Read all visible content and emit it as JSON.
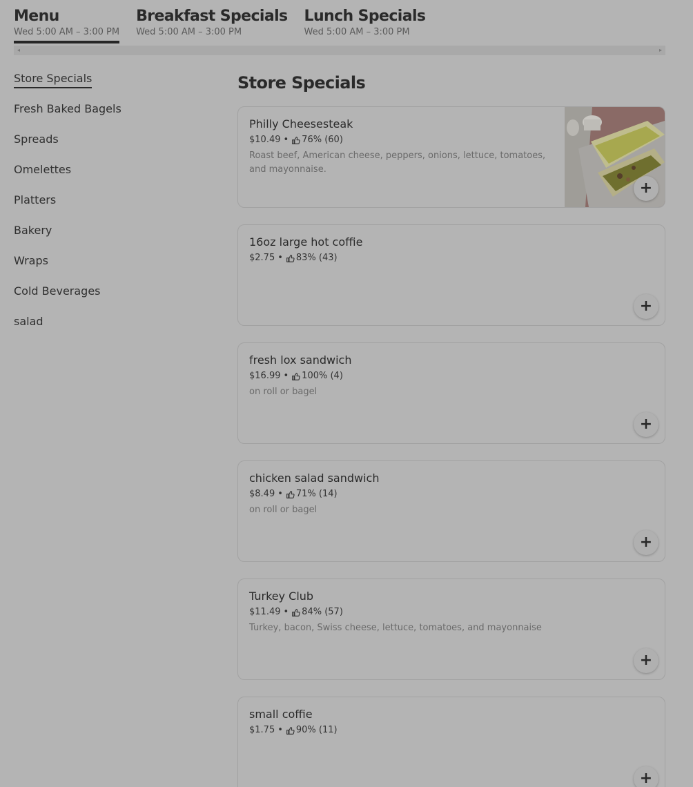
{
  "menus": [
    {
      "title": "Menu",
      "hours": "Wed 5:00 AM – 3:00 PM",
      "active": true
    },
    {
      "title": "Breakfast Specials",
      "hours": "Wed 5:00 AM – 3:00 PM",
      "active": false
    },
    {
      "title": "Lunch Specials",
      "hours": "Wed 5:00 AM – 3:00 PM",
      "active": false
    }
  ],
  "sidebar": {
    "items": [
      {
        "label": "Store Specials",
        "active": true
      },
      {
        "label": "Fresh Baked Bagels"
      },
      {
        "label": "Spreads"
      },
      {
        "label": "Omelettes"
      },
      {
        "label": "Platters"
      },
      {
        "label": "Bakery"
      },
      {
        "label": "Wraps"
      },
      {
        "label": "Cold Beverages"
      },
      {
        "label": "salad"
      }
    ]
  },
  "section": {
    "title": "Store Specials",
    "items": [
      {
        "name": "Philly Cheesesteak",
        "price": "$10.49",
        "rating": "76% (60)",
        "description": "Roast beef, American cheese, peppers, onions, lettuce, tomatoes, and mayonnaise.",
        "has_image": true
      },
      {
        "name": "16oz large hot coffie",
        "price": "$2.75",
        "rating": "83% (43)",
        "description": ""
      },
      {
        "name": "fresh lox sandwich",
        "price": "$16.99",
        "rating": "100% (4)",
        "description": "on roll or bagel"
      },
      {
        "name": "chicken salad sandwich",
        "price": "$8.49",
        "rating": "71% (14)",
        "description": "on roll or bagel"
      },
      {
        "name": "Turkey Club",
        "price": "$11.49",
        "rating": "84% (57)",
        "description": "Turkey, bacon, Swiss cheese, lettuce, tomatoes, and mayonnaise"
      },
      {
        "name": "small coffie",
        "price": "$1.75",
        "rating": "90% (11)",
        "description": ""
      }
    ]
  },
  "ui": {
    "separator": "•",
    "add_label": "+",
    "thumb_icon": "thumbs-up-icon",
    "scroll_left": "◂",
    "scroll_right": "▸"
  }
}
